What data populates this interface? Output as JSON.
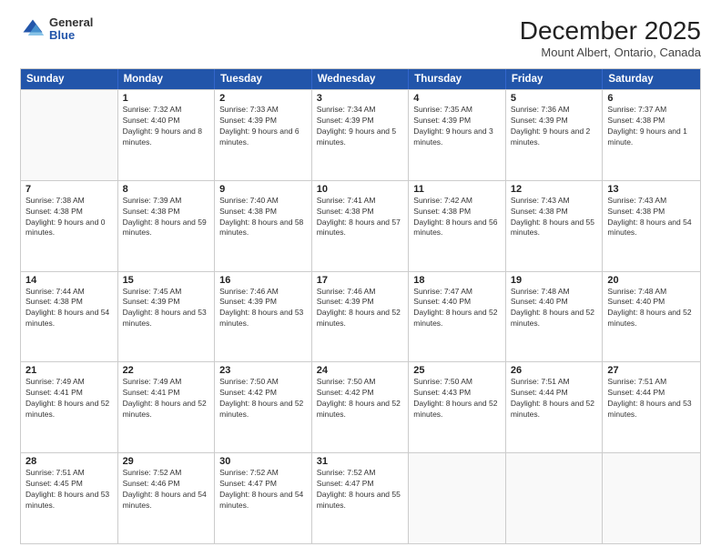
{
  "logo": {
    "general": "General",
    "blue": "Blue"
  },
  "header": {
    "title": "December 2025",
    "subtitle": "Mount Albert, Ontario, Canada"
  },
  "days_of_week": [
    "Sunday",
    "Monday",
    "Tuesday",
    "Wednesday",
    "Thursday",
    "Friday",
    "Saturday"
  ],
  "weeks": [
    [
      {
        "day": "",
        "sunrise": "",
        "sunset": "",
        "daylight": ""
      },
      {
        "day": "1",
        "sunrise": "Sunrise: 7:32 AM",
        "sunset": "Sunset: 4:40 PM",
        "daylight": "Daylight: 9 hours and 8 minutes."
      },
      {
        "day": "2",
        "sunrise": "Sunrise: 7:33 AM",
        "sunset": "Sunset: 4:39 PM",
        "daylight": "Daylight: 9 hours and 6 minutes."
      },
      {
        "day": "3",
        "sunrise": "Sunrise: 7:34 AM",
        "sunset": "Sunset: 4:39 PM",
        "daylight": "Daylight: 9 hours and 5 minutes."
      },
      {
        "day": "4",
        "sunrise": "Sunrise: 7:35 AM",
        "sunset": "Sunset: 4:39 PM",
        "daylight": "Daylight: 9 hours and 3 minutes."
      },
      {
        "day": "5",
        "sunrise": "Sunrise: 7:36 AM",
        "sunset": "Sunset: 4:39 PM",
        "daylight": "Daylight: 9 hours and 2 minutes."
      },
      {
        "day": "6",
        "sunrise": "Sunrise: 7:37 AM",
        "sunset": "Sunset: 4:38 PM",
        "daylight": "Daylight: 9 hours and 1 minute."
      }
    ],
    [
      {
        "day": "7",
        "sunrise": "Sunrise: 7:38 AM",
        "sunset": "Sunset: 4:38 PM",
        "daylight": "Daylight: 9 hours and 0 minutes."
      },
      {
        "day": "8",
        "sunrise": "Sunrise: 7:39 AM",
        "sunset": "Sunset: 4:38 PM",
        "daylight": "Daylight: 8 hours and 59 minutes."
      },
      {
        "day": "9",
        "sunrise": "Sunrise: 7:40 AM",
        "sunset": "Sunset: 4:38 PM",
        "daylight": "Daylight: 8 hours and 58 minutes."
      },
      {
        "day": "10",
        "sunrise": "Sunrise: 7:41 AM",
        "sunset": "Sunset: 4:38 PM",
        "daylight": "Daylight: 8 hours and 57 minutes."
      },
      {
        "day": "11",
        "sunrise": "Sunrise: 7:42 AM",
        "sunset": "Sunset: 4:38 PM",
        "daylight": "Daylight: 8 hours and 56 minutes."
      },
      {
        "day": "12",
        "sunrise": "Sunrise: 7:43 AM",
        "sunset": "Sunset: 4:38 PM",
        "daylight": "Daylight: 8 hours and 55 minutes."
      },
      {
        "day": "13",
        "sunrise": "Sunrise: 7:43 AM",
        "sunset": "Sunset: 4:38 PM",
        "daylight": "Daylight: 8 hours and 54 minutes."
      }
    ],
    [
      {
        "day": "14",
        "sunrise": "Sunrise: 7:44 AM",
        "sunset": "Sunset: 4:38 PM",
        "daylight": "Daylight: 8 hours and 54 minutes."
      },
      {
        "day": "15",
        "sunrise": "Sunrise: 7:45 AM",
        "sunset": "Sunset: 4:39 PM",
        "daylight": "Daylight: 8 hours and 53 minutes."
      },
      {
        "day": "16",
        "sunrise": "Sunrise: 7:46 AM",
        "sunset": "Sunset: 4:39 PM",
        "daylight": "Daylight: 8 hours and 53 minutes."
      },
      {
        "day": "17",
        "sunrise": "Sunrise: 7:46 AM",
        "sunset": "Sunset: 4:39 PM",
        "daylight": "Daylight: 8 hours and 52 minutes."
      },
      {
        "day": "18",
        "sunrise": "Sunrise: 7:47 AM",
        "sunset": "Sunset: 4:40 PM",
        "daylight": "Daylight: 8 hours and 52 minutes."
      },
      {
        "day": "19",
        "sunrise": "Sunrise: 7:48 AM",
        "sunset": "Sunset: 4:40 PM",
        "daylight": "Daylight: 8 hours and 52 minutes."
      },
      {
        "day": "20",
        "sunrise": "Sunrise: 7:48 AM",
        "sunset": "Sunset: 4:40 PM",
        "daylight": "Daylight: 8 hours and 52 minutes."
      }
    ],
    [
      {
        "day": "21",
        "sunrise": "Sunrise: 7:49 AM",
        "sunset": "Sunset: 4:41 PM",
        "daylight": "Daylight: 8 hours and 52 minutes."
      },
      {
        "day": "22",
        "sunrise": "Sunrise: 7:49 AM",
        "sunset": "Sunset: 4:41 PM",
        "daylight": "Daylight: 8 hours and 52 minutes."
      },
      {
        "day": "23",
        "sunrise": "Sunrise: 7:50 AM",
        "sunset": "Sunset: 4:42 PM",
        "daylight": "Daylight: 8 hours and 52 minutes."
      },
      {
        "day": "24",
        "sunrise": "Sunrise: 7:50 AM",
        "sunset": "Sunset: 4:42 PM",
        "daylight": "Daylight: 8 hours and 52 minutes."
      },
      {
        "day": "25",
        "sunrise": "Sunrise: 7:50 AM",
        "sunset": "Sunset: 4:43 PM",
        "daylight": "Daylight: 8 hours and 52 minutes."
      },
      {
        "day": "26",
        "sunrise": "Sunrise: 7:51 AM",
        "sunset": "Sunset: 4:44 PM",
        "daylight": "Daylight: 8 hours and 52 minutes."
      },
      {
        "day": "27",
        "sunrise": "Sunrise: 7:51 AM",
        "sunset": "Sunset: 4:44 PM",
        "daylight": "Daylight: 8 hours and 53 minutes."
      }
    ],
    [
      {
        "day": "28",
        "sunrise": "Sunrise: 7:51 AM",
        "sunset": "Sunset: 4:45 PM",
        "daylight": "Daylight: 8 hours and 53 minutes."
      },
      {
        "day": "29",
        "sunrise": "Sunrise: 7:52 AM",
        "sunset": "Sunset: 4:46 PM",
        "daylight": "Daylight: 8 hours and 54 minutes."
      },
      {
        "day": "30",
        "sunrise": "Sunrise: 7:52 AM",
        "sunset": "Sunset: 4:47 PM",
        "daylight": "Daylight: 8 hours and 54 minutes."
      },
      {
        "day": "31",
        "sunrise": "Sunrise: 7:52 AM",
        "sunset": "Sunset: 4:47 PM",
        "daylight": "Daylight: 8 hours and 55 minutes."
      },
      {
        "day": "",
        "sunrise": "",
        "sunset": "",
        "daylight": ""
      },
      {
        "day": "",
        "sunrise": "",
        "sunset": "",
        "daylight": ""
      },
      {
        "day": "",
        "sunrise": "",
        "sunset": "",
        "daylight": ""
      }
    ]
  ]
}
